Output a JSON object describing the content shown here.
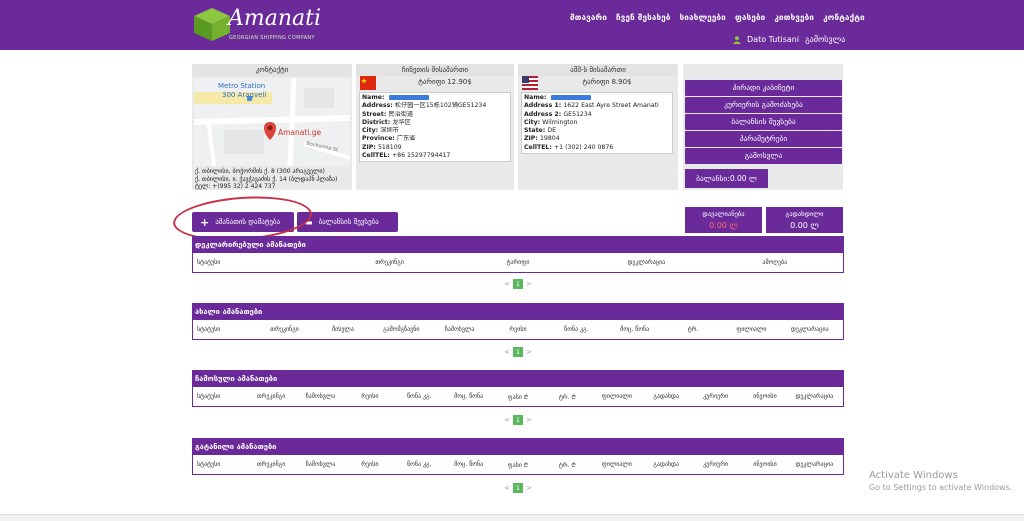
{
  "brand": {
    "name": "Amanati",
    "tagline": "GEORGIAN SHIPPING COMPANY",
    "color": "#6a2a99",
    "accent": "#8dc63f"
  },
  "nav": [
    "მთავარი",
    "ჩვენ შესახებ",
    "სიახლეები",
    "ფასები",
    "კითხვები",
    "კონტაქტი"
  ],
  "user": {
    "name": "Dato Tutisani",
    "logout": "გამოსვლა",
    "icon": "user-icon"
  },
  "contacts": {
    "title": "კონტაქტი",
    "map": {
      "station": "Metro Station",
      "station_sub": "300 Aragveli",
      "pin_label": "Amanati.ge",
      "street": "Bochorma St"
    },
    "address": [
      "ქ. თბილისი, ბოჭორმის ქ. 8 (300 არაგველი)",
      "ქ. თბილისი, ი. ჭავჭავაძის ქ. 14 (ბლდაპნ პლაზა)",
      "ტელ: +(995 32) 2 424 737"
    ]
  },
  "china": {
    "title": "ჩინეთის მისამართი",
    "tariff": "ტარიფი 12.90$",
    "fields": [
      {
        "k": "Name:",
        "v": ""
      },
      {
        "k": "Address:",
        "v": "松仔园一区15栋102铺GE51234"
      },
      {
        "k": "Street:",
        "v": "民治街道"
      },
      {
        "k": "District:",
        "v": "龙华区"
      },
      {
        "k": "City:",
        "v": "深圳市"
      },
      {
        "k": "Province:",
        "v": "广东省"
      },
      {
        "k": "ZIP:",
        "v": "518109"
      },
      {
        "k": "CellTEL:",
        "v": "+86 15297794417"
      }
    ]
  },
  "usa": {
    "title": "აშშ-ს მისამართი",
    "tariff": "ტარიფი 8.90$",
    "fields": [
      {
        "k": "Name:",
        "v": ""
      },
      {
        "k": "Address 1:",
        "v": "1622 East Ayre Street Amanati"
      },
      {
        "k": "Address 2:",
        "v": "GE51234"
      },
      {
        "k": "City:",
        "v": "Wilmington"
      },
      {
        "k": "State:",
        "v": "DE"
      },
      {
        "k": "ZIP:",
        "v": "19804"
      },
      {
        "k": "CellTEL:",
        "v": "+1 (302) 240 0876"
      }
    ]
  },
  "actions": [
    "პირადი კაბინეტი",
    "კურიერის გამოძახება",
    "ბალანსის შევსება",
    "პარამეტრები",
    "გამოსვლა"
  ],
  "balance": "ბალანსი:0.00 ლ",
  "buttons": {
    "add_parcel": "ამანათის დამატება",
    "top_up": "ბალანსის შევსება"
  },
  "stats": [
    {
      "label": "დავალიანება",
      "value": "0.00 ლ"
    },
    {
      "label": "გადახდილი",
      "value": "0.00 ლ"
    }
  ],
  "panels": [
    {
      "title": "დეკლარირებული ამანათები",
      "cols": [
        "სტატუსი",
        "თრეკინგი",
        "ტარიფი",
        "დეკლარაცია",
        "ამოღება"
      ]
    },
    {
      "title": "ახალი ამანათები",
      "cols": [
        "სტატუსი",
        "თრეკინგი",
        "მისვლა",
        "გამომგზავნი",
        "ჩამოსვლა",
        "რეისი",
        "წონა კგ.",
        "მოც. წონა",
        "ტრ.",
        "ფილიალი",
        "დეკლარაცია"
      ]
    },
    {
      "title": "ჩამოსული ამანათები",
      "cols": [
        "სტატუსი",
        "თრეკინგი",
        "ჩამოსვლა",
        "რეისი",
        "წონა კგ.",
        "მოც. წონა",
        "ფასი ₾",
        "ტრ. ₾",
        "ფილიალი",
        "გადახდა",
        "კურიერი",
        "ინვოისი",
        "დეკლარაცია"
      ]
    },
    {
      "title": "გატანილი ამანათები",
      "cols": [
        "სტატუსი",
        "თრეკინგი",
        "ჩამოსვლა",
        "რეისი",
        "წონა კგ.",
        "მოც. წონა",
        "ფასი ₾",
        "ტრ. ₾",
        "ფილიალი",
        "გადახდა",
        "კურიერი",
        "ინვოისი",
        "დეკლარაცია"
      ]
    }
  ],
  "pager": {
    "prev": "<",
    "current": "1",
    "next": ">"
  },
  "watermark": {
    "title": "Activate Windows",
    "sub": "Go to Settings to activate Windows."
  }
}
